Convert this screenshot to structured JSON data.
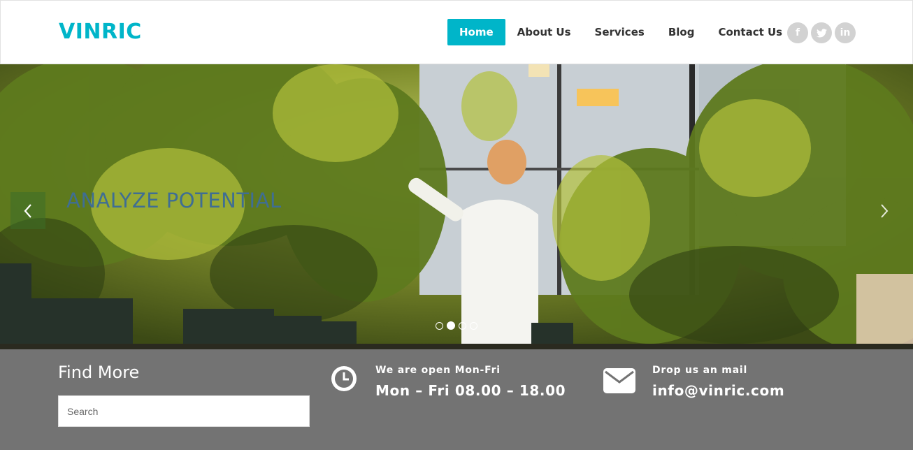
{
  "brand": {
    "logo": "VINRIC",
    "accent_color": "#00b5c9"
  },
  "nav": {
    "items": [
      {
        "label": "Home",
        "active": true
      },
      {
        "label": "About Us",
        "active": false
      },
      {
        "label": "Services",
        "active": false
      },
      {
        "label": "Blog",
        "active": false
      },
      {
        "label": "Contact Us",
        "active": false
      }
    ]
  },
  "social": [
    {
      "icon": "facebook-icon",
      "glyph": "f"
    },
    {
      "icon": "twitter-icon",
      "glyph": "t"
    },
    {
      "icon": "linkedin-icon",
      "glyph": "in"
    }
  ],
  "hero": {
    "title": "ANALYZE POTENTIAL",
    "slides": 4,
    "active_slide": 2
  },
  "find_more": {
    "title": "Find More",
    "search_placeholder": "Search"
  },
  "hours": {
    "icon": "clock-icon",
    "label": "We are open Mon-Fri",
    "value": "Mon – Fri 08.00 – 18.00"
  },
  "mail": {
    "icon": "envelope-icon",
    "label": "Drop us an mail",
    "value": "info@vinric.com"
  }
}
